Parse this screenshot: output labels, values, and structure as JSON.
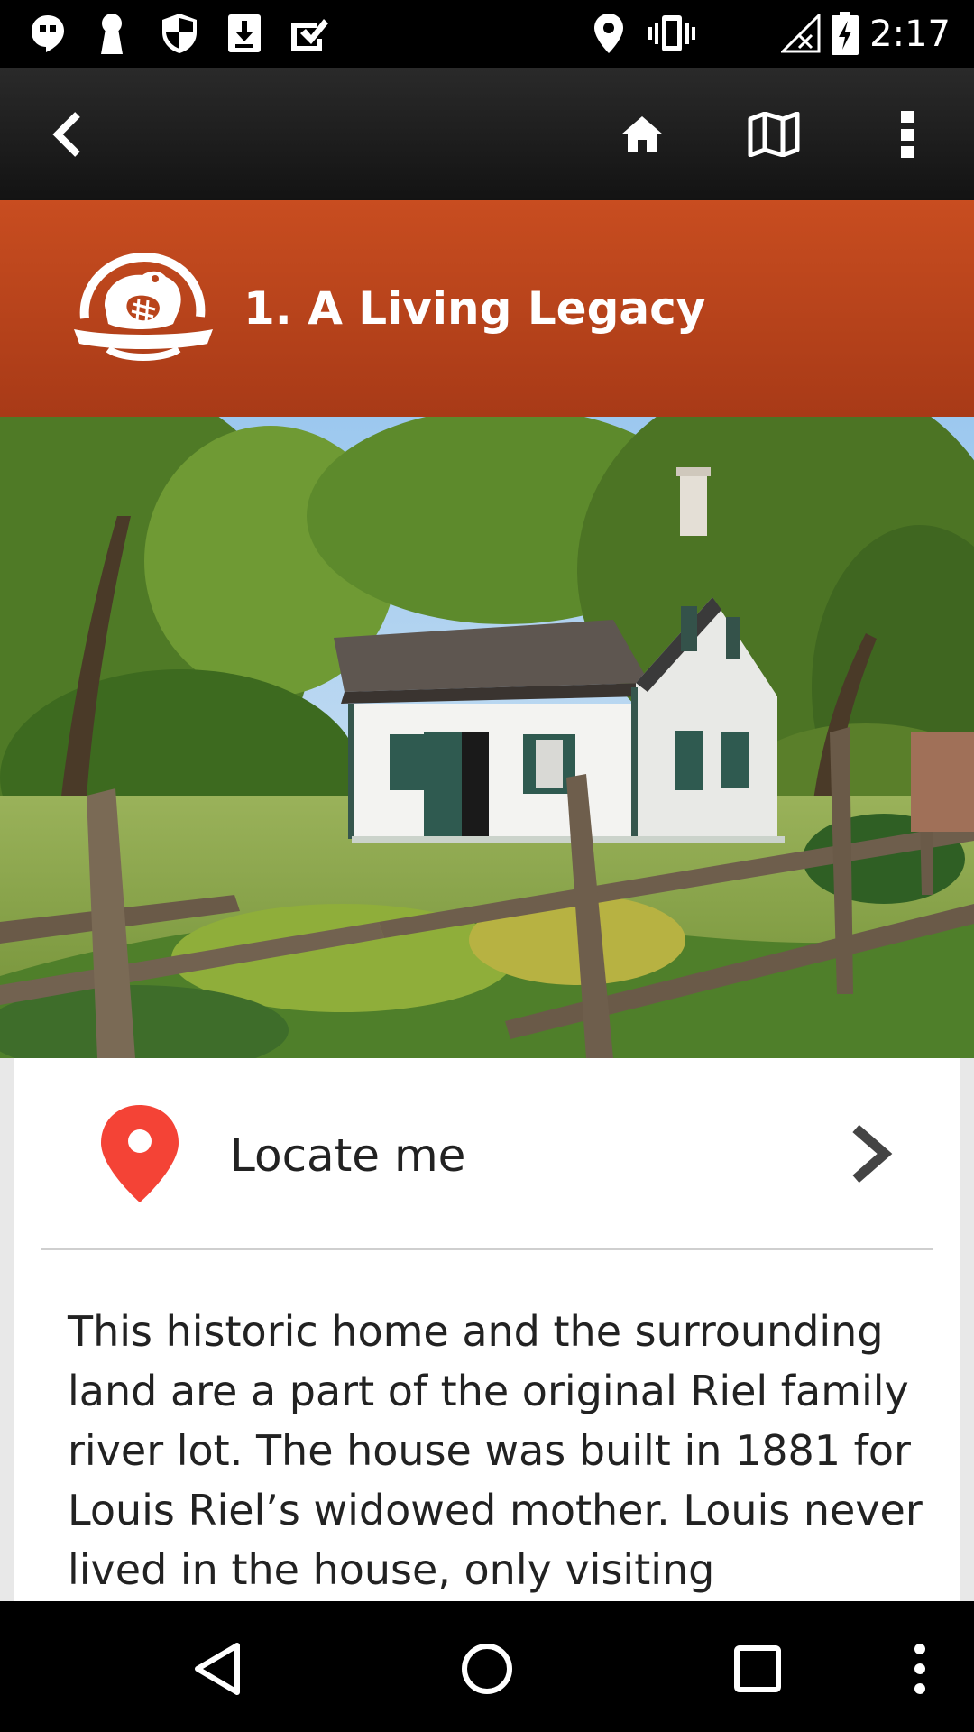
{
  "status_bar": {
    "time": "2:17",
    "left_icons": [
      "hangouts-icon",
      "keyhole-icon",
      "shield-icon",
      "download-icon",
      "checkmark-icon"
    ],
    "right_icons": [
      "location-icon",
      "vibrate-icon",
      "no-signal-icon",
      "battery-charging-icon"
    ]
  },
  "app_bar": {
    "back_icon": "back-arrow-icon",
    "home_icon": "home-icon",
    "map_icon": "map-icon",
    "overflow_icon": "overflow-menu-icon"
  },
  "banner": {
    "title": "1. A Living Legacy",
    "logo_icon": "parks-canada-beaver-logo",
    "color": "#b9441b"
  },
  "locate": {
    "label": "Locate me",
    "pin_color": "#f44336"
  },
  "description": "This historic home and the surrounding land are a part of the original Riel family river lot. The house was built in 1881 for Louis Riel’s widowed mother. Louis never lived in the house, only visiting",
  "nav_bar": {
    "icons": [
      "back-triangle-icon",
      "home-circle-icon",
      "recents-square-icon",
      "more-dots-icon"
    ]
  }
}
